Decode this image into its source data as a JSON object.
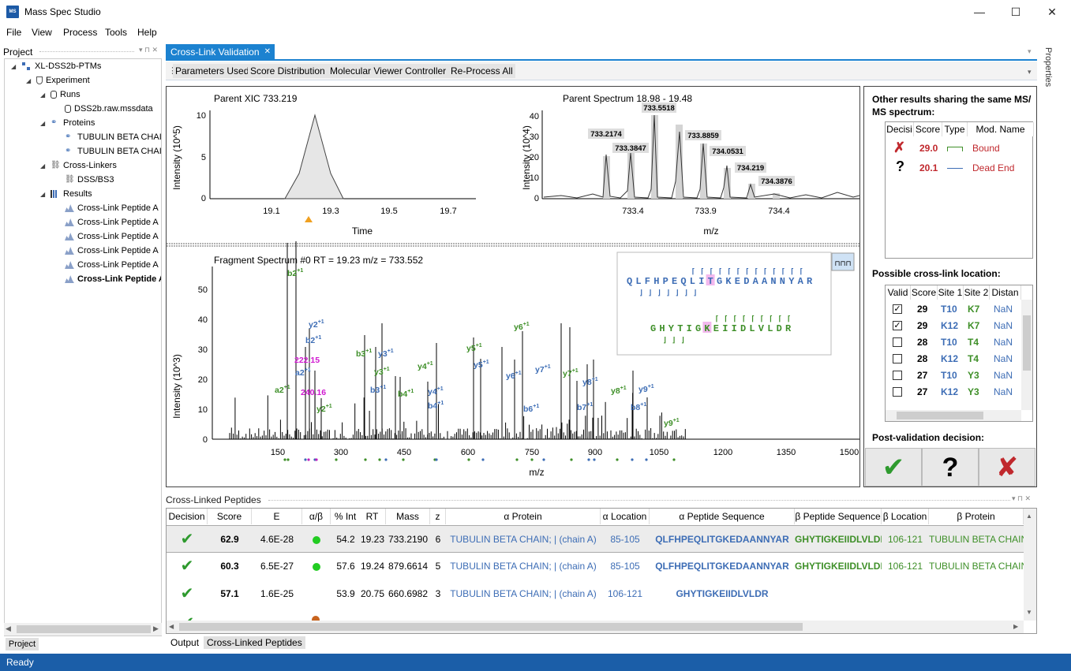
{
  "app": {
    "title": "Mass Spec Studio",
    "icon_text": "MS",
    "accent": "#1c82d0",
    "status_color": "#1b5ea8"
  },
  "window": {
    "minimize": "—",
    "maximize": "☐",
    "close": "✕"
  },
  "menu": [
    "File",
    "View",
    "Process",
    "Tools",
    "Help"
  ],
  "status": "Ready",
  "project": {
    "title": "Project",
    "tab": "Project",
    "tree": [
      {
        "label": "XL-DSS2b-PTMs",
        "icon": "project-icon"
      },
      {
        "label": "Experiment",
        "icon": "flask-icon"
      },
      {
        "label": "Runs",
        "icon": "database-icon"
      },
      {
        "label": "DSS2b.raw.mssdata",
        "icon": "database-icon"
      },
      {
        "label": "Proteins",
        "icon": "protein-icon"
      },
      {
        "label": "TUBULIN BETA CHAIN",
        "icon": "protein-icon"
      },
      {
        "label": "TUBULIN BETA CHAIN",
        "icon": "protein-icon"
      },
      {
        "label": "Cross-Linkers",
        "icon": "link-icon"
      },
      {
        "label": "DSS/BS3",
        "icon": "link-icon"
      },
      {
        "label": "Results",
        "icon": "chart-icon"
      },
      {
        "label": "Cross-Link Peptide A",
        "icon": "spectrum-icon"
      },
      {
        "label": "Cross-Link Peptide A",
        "icon": "spectrum-icon"
      },
      {
        "label": "Cross-Link Peptide A",
        "icon": "spectrum-icon"
      },
      {
        "label": "Cross-Link Peptide A",
        "icon": "spectrum-icon"
      },
      {
        "label": "Cross-Link Peptide A",
        "icon": "spectrum-icon"
      },
      {
        "label": "Cross-Link Peptide A",
        "icon": "spectrum-icon"
      }
    ]
  },
  "document": {
    "tab": "Cross-Link Validation",
    "tab_close": "✕",
    "toolbar": [
      "Parameters Used",
      "Score Distribution",
      "Molecular Viewer Controller",
      "Re-Process All"
    ]
  },
  "xic": {
    "title": "Parent XIC 733.219",
    "xlabel": "Time",
    "ylabel": "Intensity (10^5)",
    "xticks": [
      "19.1",
      "19.3",
      "19.5",
      "19.7"
    ],
    "yticks": [
      "0",
      "5",
      "10"
    ]
  },
  "parent": {
    "title": "Parent Spectrum 18.98 - 19.48",
    "xlabel": "m/z",
    "ylabel": "Intensity (10^4)",
    "xticks": [
      "733.4",
      "733.9",
      "734.4"
    ],
    "yticks": [
      "0",
      "10",
      "20",
      "30",
      "40"
    ],
    "peak_labels": [
      "733.5518",
      "733.2174",
      "733.8859",
      "733.3847",
      "734.0531",
      "734.219",
      "734.3876"
    ]
  },
  "fragment": {
    "title": "Fragment Spectrum #0 RT = 19.23 m/z = 733.552",
    "xlabel": "m/z",
    "ylabel": "Intensity (10^3)",
    "xticks": [
      "150",
      "300",
      "450",
      "600",
      "750",
      "900",
      "1050",
      "1200",
      "1350",
      "1500"
    ],
    "yticks": [
      "0",
      "10",
      "20",
      "30",
      "40",
      "50"
    ],
    "seq_alpha": "QLFHPEQLITGKEDAANNYAR",
    "seq_beta": "GHYTIGKEIIDLVLDR",
    "ion_labels": [
      {
        "t": "b2",
        "c": "green"
      },
      {
        "t": "y2",
        "c": "blue"
      },
      {
        "t": "b2",
        "c": "blue"
      },
      {
        "t": "222.15",
        "c": "magenta"
      },
      {
        "t": "a2",
        "c": "blue"
      },
      {
        "t": "240.16",
        "c": "magenta"
      },
      {
        "t": "a2",
        "c": "green"
      },
      {
        "t": "y2",
        "c": "green"
      },
      {
        "t": "b3",
        "c": "green"
      },
      {
        "t": "y3",
        "c": "blue"
      },
      {
        "t": "y3",
        "c": "green"
      },
      {
        "t": "b3",
        "c": "blue"
      },
      {
        "t": "y4",
        "c": "green"
      },
      {
        "t": "b4",
        "c": "green"
      },
      {
        "t": "y4",
        "c": "blue"
      },
      {
        "t": "b4",
        "c": "blue"
      },
      {
        "t": "y5",
        "c": "green"
      },
      {
        "t": "y5",
        "c": "blue"
      },
      {
        "t": "y6",
        "c": "green"
      },
      {
        "t": "y6",
        "c": "blue"
      },
      {
        "t": "y7",
        "c": "blue"
      },
      {
        "t": "b6",
        "c": "blue"
      },
      {
        "t": "y7",
        "c": "green"
      },
      {
        "t": "y8",
        "c": "blue"
      },
      {
        "t": "b7",
        "c": "blue"
      },
      {
        "t": "y8",
        "c": "green"
      },
      {
        "t": "y9",
        "c": "blue"
      },
      {
        "t": "b8",
        "c": "blue"
      },
      {
        "t": "y9",
        "c": "green"
      }
    ]
  },
  "side": {
    "other_title": "Other results sharing the same MS/ MS spectrum:",
    "other_headers": [
      "Decisi",
      "Score",
      "Type",
      "Mod. Name"
    ],
    "other_rows": [
      {
        "decision": "✗",
        "score": "29.0",
        "mod": "Bound"
      },
      {
        "decision": "?",
        "score": "20.1",
        "mod": "Dead End"
      }
    ],
    "loc_title": "Possible cross-link location:",
    "loc_headers": [
      "Valid",
      "Score",
      "Site 1",
      "Site 2",
      "Distan"
    ],
    "loc_rows": [
      {
        "valid": true,
        "score": "29",
        "s1": "T10",
        "s2": "K7",
        "d": "NaN"
      },
      {
        "valid": true,
        "score": "29",
        "s1": "K12",
        "s2": "K7",
        "d": "NaN"
      },
      {
        "valid": false,
        "score": "28",
        "s1": "T10",
        "s2": "T4",
        "d": "NaN"
      },
      {
        "valid": false,
        "score": "28",
        "s1": "K12",
        "s2": "T4",
        "d": "NaN"
      },
      {
        "valid": false,
        "score": "27",
        "s1": "T10",
        "s2": "Y3",
        "d": "NaN"
      },
      {
        "valid": false,
        "score": "27",
        "s1": "K12",
        "s2": "Y3",
        "d": "NaN"
      }
    ],
    "post_title": "Post-validation decision:",
    "decisions": [
      "✔",
      "?",
      "✘"
    ]
  },
  "grid": {
    "title": "Cross-Linked Peptides",
    "headers": [
      "Decision",
      "Score",
      "E",
      "α/β",
      "% Int",
      "RT",
      "Mass",
      "z",
      "α Protein",
      "α Location",
      "α Peptide Sequence",
      "β Peptide Sequence",
      "β Location",
      "β Protein"
    ],
    "rows": [
      {
        "decision": "✔",
        "score": "62.9",
        "e": "4.6E-28",
        "ab": "green",
        "int": "54.2",
        "rt": "19.23",
        "mass": "733.2190",
        "z": "6",
        "aprot": "TUBULIN BETA CHAIN; | (chain A)",
        "aloc": "85-105",
        "apep": "QLFHPEQLITGKEDAANNYAR",
        "bpep": "GHYTIGKEIIDLVLDR",
        "bloc": "106-121",
        "bprot": "TUBULIN BETA CHAIN"
      },
      {
        "decision": "✔",
        "score": "60.3",
        "e": "6.5E-27",
        "ab": "green",
        "int": "57.6",
        "rt": "19.24",
        "mass": "879.6614",
        "z": "5",
        "aprot": "TUBULIN BETA CHAIN; | (chain A)",
        "aloc": "85-105",
        "apep": "QLFHPEQLITGKEDAANNYAR",
        "bpep": "GHYTIGKEIIDLVLDR",
        "bloc": "106-121",
        "bprot": "TUBULIN BETA CHAIN"
      },
      {
        "decision": "✔",
        "score": "57.1",
        "e": "1.6E-25",
        "ab": "",
        "int": "53.9",
        "rt": "20.75",
        "mass": "660.6982",
        "z": "3",
        "aprot": "TUBULIN BETA CHAIN; | (chain A)",
        "aloc": "106-121",
        "apep": "GHYTIGKEIIDLVLDR",
        "bpep": "",
        "bloc": "",
        "bprot": ""
      }
    ]
  },
  "bottom_tabs": [
    "Output",
    "Cross-Linked Peptides"
  ],
  "properties": "Properties"
}
